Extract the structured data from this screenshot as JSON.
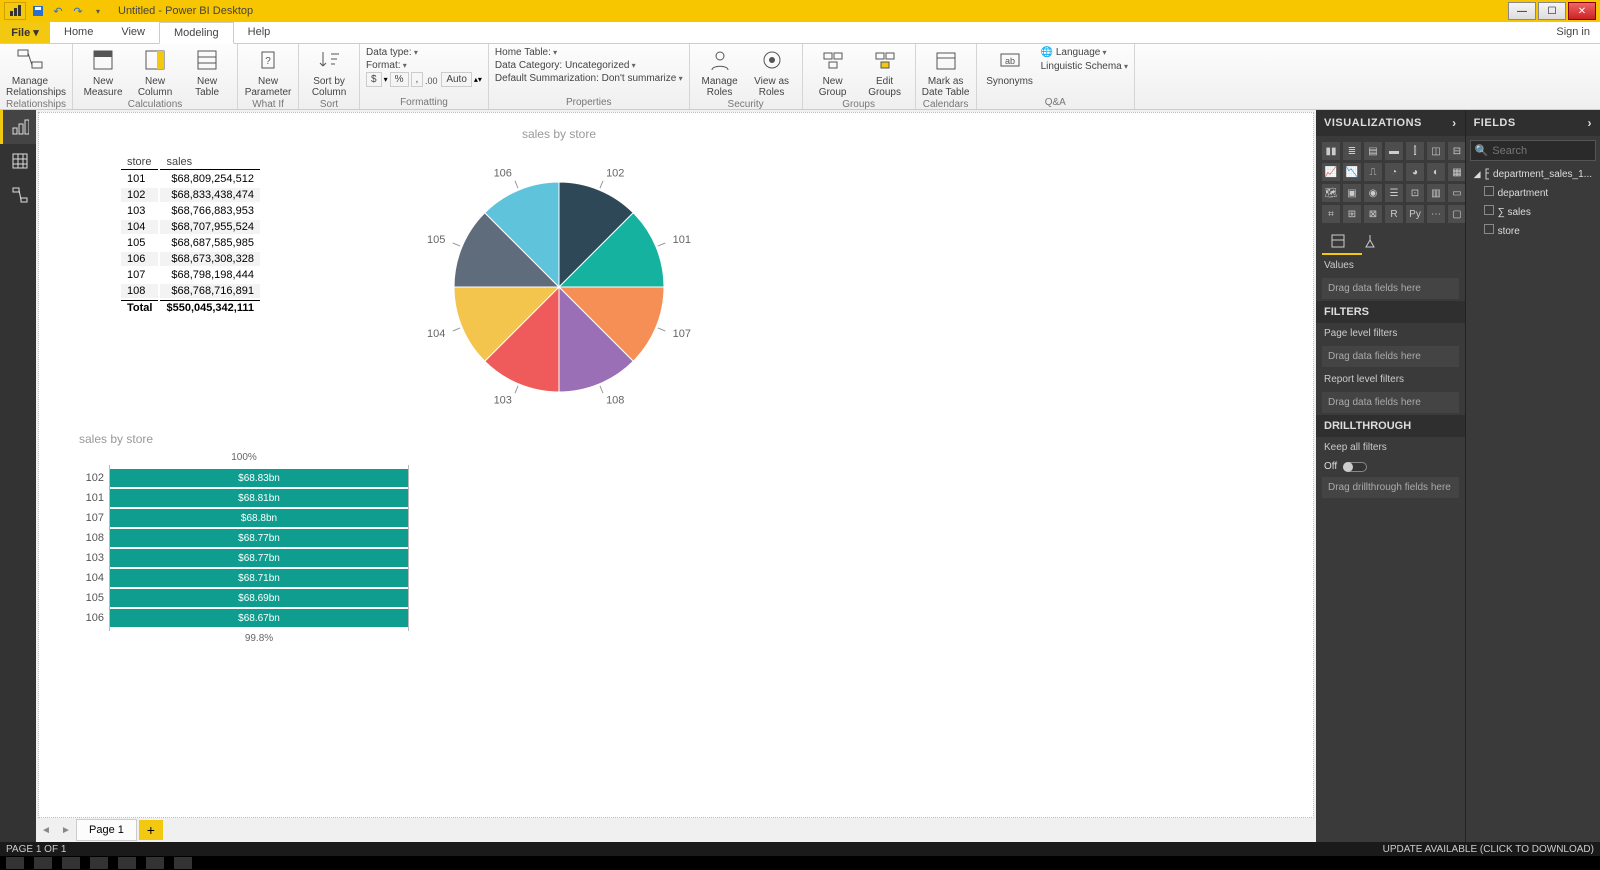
{
  "app": {
    "title": "Untitled - Power BI Desktop",
    "signin": "Sign in"
  },
  "ribbon_tabs": {
    "file": "File ▾",
    "items": [
      "Home",
      "View",
      "Modeling",
      "Help"
    ],
    "active": 2
  },
  "ribbon": {
    "relationships": {
      "name": "Relationships",
      "manage": "Manage\nRelationships"
    },
    "calculations": {
      "name": "Calculations",
      "measure": "New\nMeasure",
      "column": "New\nColumn",
      "table": "New\nTable"
    },
    "whatif": {
      "name": "What If",
      "param": "New\nParameter"
    },
    "sort": {
      "name": "Sort",
      "sort": "Sort by\nColumn"
    },
    "formatting": {
      "name": "Formatting",
      "datatype": "Data type:",
      "format": "Format:",
      "curbtn": "$",
      "pct": "%",
      "comma": ",",
      "auto": "Auto"
    },
    "properties": {
      "name": "Properties",
      "hometable": "Home Table:",
      "datacat": "Data Category: Uncategorized",
      "summ": "Default Summarization: Don't summarize"
    },
    "security": {
      "name": "Security",
      "manage": "Manage\nRoles",
      "view": "View as\nRoles"
    },
    "groups": {
      "name": "Groups",
      "new": "New\nGroup",
      "edit": "Edit\nGroups"
    },
    "calendars": {
      "name": "Calendars",
      "mark": "Mark as\nDate Table"
    },
    "qa": {
      "name": "Q&A",
      "syn": "Synonyms",
      "lang": "Language",
      "ling": "Linguistic Schema"
    }
  },
  "page": {
    "tab": "Page 1",
    "status": "PAGE 1 OF 1",
    "update": "UPDATE AVAILABLE (CLICK TO DOWNLOAD)"
  },
  "viz": {
    "title": "VISUALIZATIONS",
    "values": "Values",
    "dragvalues": "Drag data fields here",
    "filters": "FILTERS",
    "pagefilters": "Page level filters",
    "dragpage": "Drag data fields here",
    "reportfilters": "Report level filters",
    "dragreport": "Drag data fields here",
    "drill": "DRILLTHROUGH",
    "keepall": "Keep all filters",
    "off": "Off",
    "dragdrill": "Drag drillthrough fields here"
  },
  "fields": {
    "title": "FIELDS",
    "search": "Search",
    "table": "department_sales_1...",
    "cols": [
      "department",
      "sales",
      "store"
    ]
  },
  "chart_data": [
    {
      "type": "table",
      "title": "",
      "columns": [
        "store",
        "sales"
      ],
      "rows": [
        [
          "101",
          "$68,809,254,512"
        ],
        [
          "102",
          "$68,833,438,474"
        ],
        [
          "103",
          "$68,766,883,953"
        ],
        [
          "104",
          "$68,707,955,524"
        ],
        [
          "105",
          "$68,687,585,985"
        ],
        [
          "106",
          "$68,673,308,328"
        ],
        [
          "107",
          "$68,798,198,444"
        ],
        [
          "108",
          "$68,768,716,891"
        ]
      ],
      "total": [
        "Total",
        "$550,045,342,111"
      ]
    },
    {
      "type": "pie",
      "title": "sales by store",
      "categories": [
        "101",
        "102",
        "103",
        "104",
        "105",
        "106",
        "107",
        "108"
      ],
      "values": [
        68809254512,
        68833438474,
        68766883953,
        68707955524,
        68687585985,
        68673308328,
        68798198444,
        68768716891
      ],
      "colors": [
        "#15b2a0",
        "#2f4858",
        "#ef5b5b",
        "#f4c54c",
        "#5f6c7b",
        "#5ec3db",
        "#f58f56",
        "#9b6fb6"
      ]
    },
    {
      "type": "bar",
      "title": "sales by store",
      "categories": [
        "102",
        "101",
        "107",
        "108",
        "103",
        "104",
        "105",
        "106"
      ],
      "value_labels": [
        "$68.83bn",
        "$68.81bn",
        "$68.8bn",
        "$68.77bn",
        "$68.77bn",
        "$68.71bn",
        "$68.69bn",
        "$68.67bn"
      ],
      "values": [
        68.83,
        68.81,
        68.8,
        68.77,
        68.77,
        68.71,
        68.69,
        68.67
      ],
      "top_axis": "100%",
      "bot_axis": "99.8%"
    }
  ]
}
